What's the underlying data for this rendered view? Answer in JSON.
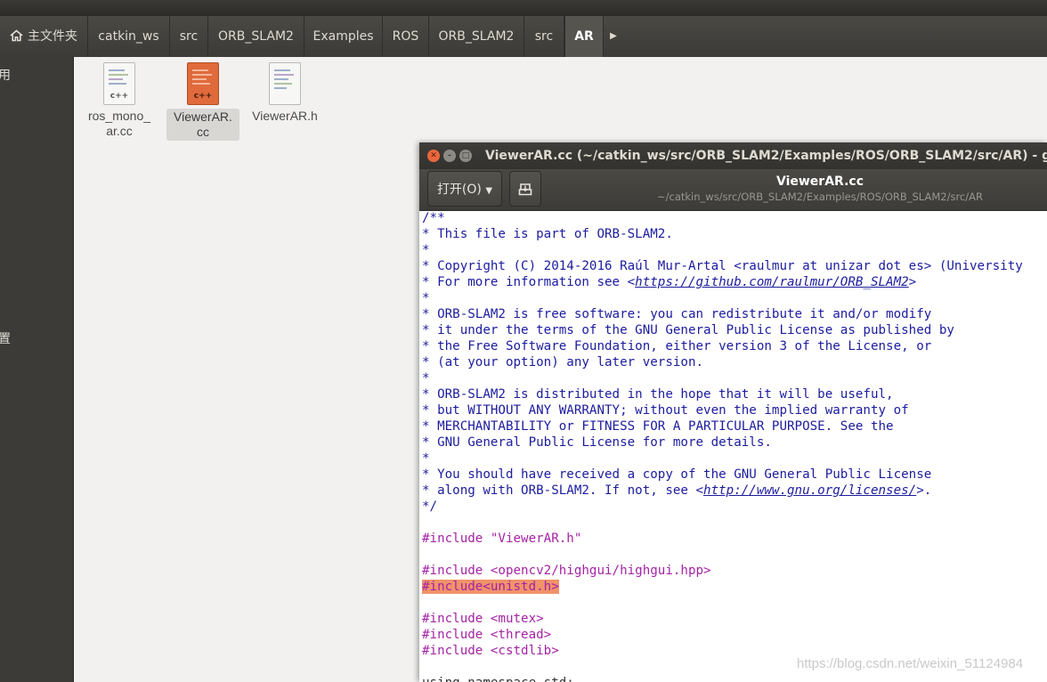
{
  "breadcrumbs": [
    "主文件夹",
    "catkin_ws",
    "src",
    "ORB_SLAM2",
    "Examples",
    "ROS",
    "ORB_SLAM2",
    "src",
    "AR"
  ],
  "sidebar": {
    "frag_top": "用",
    "frag_mid": "置"
  },
  "files": [
    {
      "name": "ros_mono_ar.cc",
      "line1": "ros_mono_",
      "line2": "ar.cc",
      "badge": "c++",
      "selected": false
    },
    {
      "name": "ViewerAR.cc",
      "line1": "ViewerAR.",
      "line2": "cc",
      "badge": "c++",
      "selected": true
    },
    {
      "name": "ViewerAR.h",
      "line1": "ViewerAR.h",
      "line2": "",
      "badge": "",
      "selected": false
    }
  ],
  "gedit": {
    "window_title": "ViewerAR.cc (~/catkin_ws/src/ORB_SLAM2/Examples/ROS/ORB_SLAM2/src/AR) - gedit",
    "open_label": "打开(O)",
    "doc_title": "ViewerAR.cc",
    "doc_path": "~/catkin_ws/src/ORB_SLAM2/Examples/ROS/ORB_SLAM2/src/AR",
    "lines": [
      {
        "kind": "comment",
        "parts": [
          {
            "t": "/**"
          }
        ]
      },
      {
        "kind": "comment",
        "parts": [
          {
            "t": "* This file is part of ORB-SLAM2."
          }
        ]
      },
      {
        "kind": "comment",
        "parts": [
          {
            "t": "*"
          }
        ]
      },
      {
        "kind": "comment",
        "parts": [
          {
            "t": "* Copyright (C) 2014-2016 Raúl Mur-Artal <raulmur at unizar dot es> (University"
          }
        ]
      },
      {
        "kind": "comment",
        "parts": [
          {
            "t": "* For more information see <"
          },
          {
            "t": "https://github.com/raulmur/ORB_SLAM2",
            "link": true
          },
          {
            "t": ">"
          }
        ]
      },
      {
        "kind": "comment",
        "parts": [
          {
            "t": "*"
          }
        ]
      },
      {
        "kind": "comment",
        "parts": [
          {
            "t": "* ORB-SLAM2 is free software: you can redistribute it and/or modify"
          }
        ]
      },
      {
        "kind": "comment",
        "parts": [
          {
            "t": "* it under the terms of the GNU General Public License as published by"
          }
        ]
      },
      {
        "kind": "comment",
        "parts": [
          {
            "t": "* the Free Software Foundation, either version 3 of the License, or"
          }
        ]
      },
      {
        "kind": "comment",
        "parts": [
          {
            "t": "* (at your option) any later version."
          }
        ]
      },
      {
        "kind": "comment",
        "parts": [
          {
            "t": "*"
          }
        ]
      },
      {
        "kind": "comment",
        "parts": [
          {
            "t": "* ORB-SLAM2 is distributed in the hope that it will be useful,"
          }
        ]
      },
      {
        "kind": "comment",
        "parts": [
          {
            "t": "* but WITHOUT ANY WARRANTY; without even the implied warranty of"
          }
        ]
      },
      {
        "kind": "comment",
        "parts": [
          {
            "t": "* MERCHANTABILITY or FITNESS FOR A PARTICULAR PURPOSE. See the"
          }
        ]
      },
      {
        "kind": "comment",
        "parts": [
          {
            "t": "* GNU General Public License for more details."
          }
        ]
      },
      {
        "kind": "comment",
        "parts": [
          {
            "t": "*"
          }
        ]
      },
      {
        "kind": "comment",
        "parts": [
          {
            "t": "* You should have received a copy of the GNU General Public License"
          }
        ]
      },
      {
        "kind": "comment",
        "parts": [
          {
            "t": "* along with ORB-SLAM2. If not, see <"
          },
          {
            "t": "http://www.gnu.org/licenses/",
            "link": true
          },
          {
            "t": ">."
          }
        ]
      },
      {
        "kind": "comment",
        "parts": [
          {
            "t": "*/"
          }
        ]
      },
      {
        "kind": "blank",
        "parts": [
          {
            "t": ""
          }
        ]
      },
      {
        "kind": "preproc",
        "parts": [
          {
            "t": "#include \"ViewerAR.h\""
          }
        ]
      },
      {
        "kind": "blank",
        "parts": [
          {
            "t": ""
          }
        ]
      },
      {
        "kind": "preproc",
        "parts": [
          {
            "t": "#include <opencv2/highgui/highgui.hpp>"
          }
        ]
      },
      {
        "kind": "preproc",
        "parts": [
          {
            "t": "#include<unistd.h>",
            "hl": true
          }
        ]
      },
      {
        "kind": "blank",
        "parts": [
          {
            "t": ""
          }
        ]
      },
      {
        "kind": "preproc",
        "parts": [
          {
            "t": "#include <mutex>"
          }
        ]
      },
      {
        "kind": "preproc",
        "parts": [
          {
            "t": "#include <thread>"
          }
        ]
      },
      {
        "kind": "preproc",
        "parts": [
          {
            "t": "#include <cstdlib>"
          }
        ]
      },
      {
        "kind": "blank",
        "parts": [
          {
            "t": ""
          }
        ]
      },
      {
        "kind": "normal",
        "parts": [
          {
            "t": "using namespace std;"
          }
        ]
      }
    ]
  },
  "watermark": "https://blog.csdn.net/weixin_51124984",
  "colors": {
    "comment": "#1c1c9e",
    "preproc": "#a523a5",
    "highlight": "#f0926a",
    "cc_icon": "#e06a3b"
  }
}
